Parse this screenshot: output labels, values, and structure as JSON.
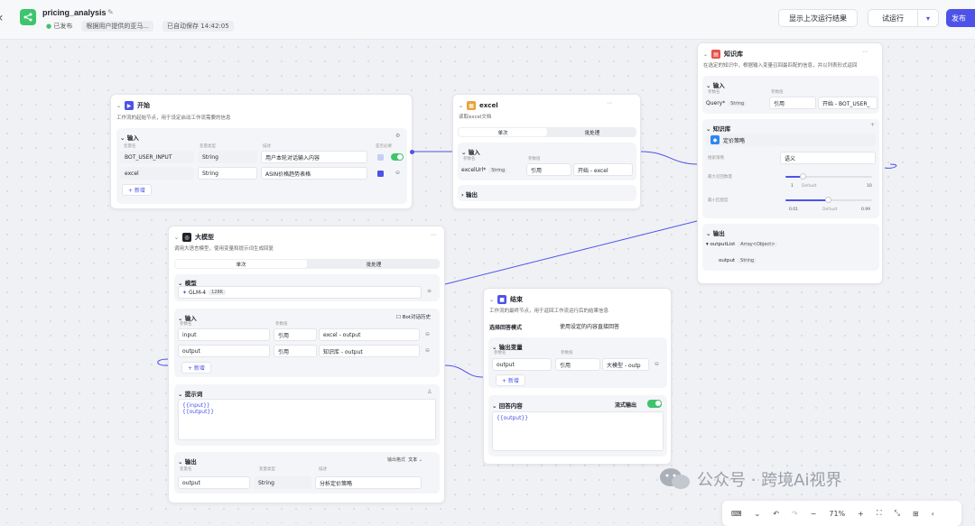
{
  "header": {
    "title": "pricing_analysis",
    "status": "已发布",
    "description": "根据用户提供的亚马...",
    "autosave": "已自动保存 14:42:05",
    "show_last_run": "显示上次运行结果",
    "test_run": "试运行",
    "publish": "发布"
  },
  "start_node": {
    "title": "开始",
    "desc": "工作流的起始节点，用于设定启动工作流需要的信息",
    "section": "输入",
    "col_name": "变量名",
    "col_type": "变量类型",
    "col_desc": "描述",
    "col_required": "是否必要",
    "rows": [
      {
        "name": "BOT_USER_INPUT",
        "type": "String",
        "desc": "用户本轮对话输入内容"
      },
      {
        "name": "excel",
        "type": "String",
        "desc": "ASIN价格趋势表格"
      }
    ],
    "add": "+ 新增"
  },
  "excel_node": {
    "title": "excel",
    "desc": "读取excel文档",
    "tab_single": "单次",
    "tab_batch": "批处理",
    "section_in": "输入",
    "col_name": "参数名",
    "col_value": "参数值",
    "param": "excelUrl*",
    "param_type": "String",
    "ref": "引用",
    "ref_val": "开始 - excel",
    "section_out": "输出"
  },
  "kb_node": {
    "title": "知识库",
    "desc": "在选定的知识中，根据输入变量召回最匹配的信息，并以列表形式返回",
    "section_in": "输入",
    "col_name": "参数名",
    "col_value": "参数值",
    "query": "Query*",
    "query_type": "String",
    "ref": "引用",
    "ref_val": "开始 - BOT_USER_",
    "section_kb": "知识库",
    "kb_item": "定价策略",
    "strategy_label": "搜索策略",
    "strategy": "语义",
    "max_label": "最大召回数量",
    "max_min": "1",
    "max_default": "Default",
    "max_max": "10",
    "score_label": "最小匹配度",
    "score_min": "0.01",
    "score_default": "Default",
    "score_max": "0.99",
    "section_out": "输出",
    "out_name": "outputList",
    "out_type": "Array<Object>",
    "out_child": "output",
    "out_child_type": "String"
  },
  "llm_node": {
    "title": "大模型",
    "desc": "调用大语言模型，使用变量和提示词生成回复",
    "tab_single": "单次",
    "tab_batch": "批处理",
    "section_model": "模型",
    "model": "GLM-4",
    "model_ctx": "128K",
    "section_in": "输入",
    "col_name": "参数名",
    "col_value": "参数值",
    "chat_history": "Bot对话历史",
    "rows": [
      {
        "name": "input",
        "ref": "引用",
        "val": "excel - output"
      },
      {
        "name": "output",
        "ref": "引用",
        "val": "知识库 - output"
      }
    ],
    "add": "+ 新增",
    "section_prompt": "提示词",
    "prompt_lines": [
      "{{input}}",
      "{{output}}"
    ],
    "section_out": "输出",
    "out_format_label": "输出格式",
    "out_format": "文本",
    "out_col_name": "变量名",
    "out_col_type": "变量类型",
    "out_col_desc": "描述",
    "out_name": "output",
    "out_type": "String",
    "out_desc": "分析定价策略"
  },
  "end_node": {
    "title": "结束",
    "desc": "工作流的最终节点，用于返回工作流运行后的结果信息",
    "mode_label": "选择回答模式",
    "mode": "使用设定的内容直接回答",
    "section_out": "输出变量",
    "col_name": "参数名",
    "col_value": "参数值",
    "out_name": "output",
    "ref": "引用",
    "ref_val": "大模型 - outp",
    "add": "+ 新增",
    "section_answer": "回答内容",
    "stream": "流式输出",
    "answer": "{{output}}"
  },
  "toolbar": {
    "zoom": "71%"
  },
  "watermark": "公众号 · 跨境Ai视界",
  "colors": {
    "accent": "#4d53e8",
    "success": "#3ec46d"
  }
}
